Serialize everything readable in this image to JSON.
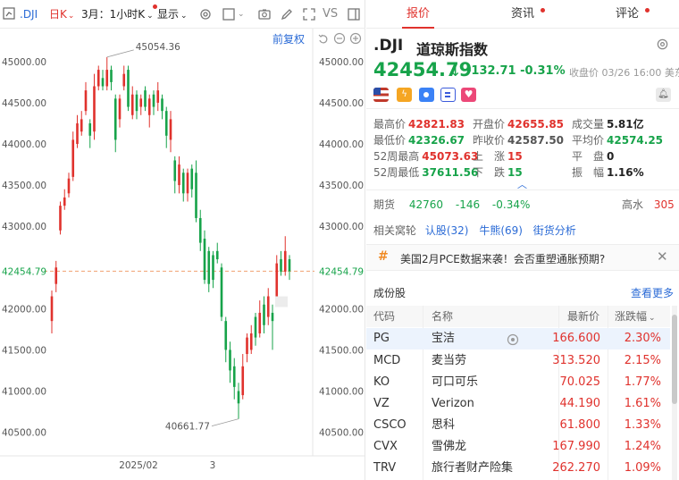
{
  "toolbar": {
    "symbol": ".DJI",
    "period": "日K",
    "range": "3月：1小时K",
    "display": "显示",
    "vs": "VS"
  },
  "chart": {
    "restore_label": "前复权",
    "current_price_label": "42454.79",
    "high_label": "45054.36",
    "low_label": "40661.77",
    "y_ticks": [
      "45000.00",
      "44500.00",
      "44000.00",
      "43500.00",
      "43000.00",
      "42000.00",
      "41500.00",
      "41000.00",
      "40500.00"
    ],
    "x_ticks": [
      "2025/02",
      "3"
    ]
  },
  "chart_data": {
    "type": "candlestick",
    "ylim": [
      40300,
      45400
    ],
    "current_price": 42454.79,
    "high": 45054.36,
    "low": 40661.77,
    "up_color": "#e0322d",
    "down_color": "#17a34a",
    "candles": [
      {
        "o": 41850,
        "c": 42150,
        "h": 42220,
        "l": 41700
      },
      {
        "o": 42300,
        "c": 42500,
        "h": 42580,
        "l": 42200
      },
      {
        "o": 42950,
        "c": 43250,
        "h": 43300,
        "l": 42900
      },
      {
        "o": 43250,
        "c": 43350,
        "h": 43450,
        "l": 43200
      },
      {
        "o": 43400,
        "c": 43580,
        "h": 43650,
        "l": 43350
      },
      {
        "o": 43600,
        "c": 44050,
        "h": 44150,
        "l": 43550
      },
      {
        "o": 44000,
        "c": 44250,
        "h": 44350,
        "l": 43950
      },
      {
        "o": 44150,
        "c": 44300,
        "h": 44400,
        "l": 44100
      },
      {
        "o": 44400,
        "c": 44650,
        "h": 44750,
        "l": 44350
      },
      {
        "o": 44250,
        "c": 44100,
        "h": 44300,
        "l": 43950
      },
      {
        "o": 44150,
        "c": 44700,
        "h": 44850,
        "l": 44050
      },
      {
        "o": 44700,
        "c": 44900,
        "h": 44950,
        "l": 44650
      },
      {
        "o": 44800,
        "c": 44700,
        "h": 44900,
        "l": 44650
      },
      {
        "o": 44700,
        "c": 44900,
        "h": 45054,
        "l": 44650
      },
      {
        "o": 44900,
        "c": 44750,
        "h": 44950,
        "l": 44650
      },
      {
        "o": 44550,
        "c": 44050,
        "h": 44600,
        "l": 43900
      },
      {
        "o": 44300,
        "c": 44550,
        "h": 44600,
        "l": 44200
      },
      {
        "o": 44700,
        "c": 44850,
        "h": 44950,
        "l": 44650
      },
      {
        "o": 44900,
        "c": 44450,
        "h": 44950,
        "l": 44400
      },
      {
        "o": 44350,
        "c": 44600,
        "h": 44700,
        "l": 44300
      },
      {
        "o": 44600,
        "c": 44400,
        "h": 44650,
        "l": 44300
      },
      {
        "o": 44450,
        "c": 44550,
        "h": 44600,
        "l": 44350
      },
      {
        "o": 44650,
        "c": 44450,
        "h": 44700,
        "l": 44400
      },
      {
        "o": 44350,
        "c": 44550,
        "h": 44600,
        "l": 44200
      },
      {
        "o": 44600,
        "c": 44450,
        "h": 44650,
        "l": 44350
      },
      {
        "o": 44500,
        "c": 44650,
        "h": 44750,
        "l": 44400
      },
      {
        "o": 44550,
        "c": 44400,
        "h": 44600,
        "l": 44300
      },
      {
        "o": 44400,
        "c": 44100,
        "h": 44450,
        "l": 43950
      },
      {
        "o": 44050,
        "c": 44300,
        "h": 44400,
        "l": 43900
      },
      {
        "o": 43800,
        "c": 43550,
        "h": 43850,
        "l": 43400
      },
      {
        "o": 43500,
        "c": 43750,
        "h": 43850,
        "l": 43400
      },
      {
        "o": 43650,
        "c": 43400,
        "h": 43700,
        "l": 43300
      },
      {
        "o": 43400,
        "c": 43650,
        "h": 43700,
        "l": 43300
      },
      {
        "o": 43700,
        "c": 43450,
        "h": 43750,
        "l": 43350
      },
      {
        "o": 43650,
        "c": 43100,
        "h": 43800,
        "l": 43050
      },
      {
        "o": 43100,
        "c": 42800,
        "h": 43200,
        "l": 42700
      },
      {
        "o": 42850,
        "c": 42350,
        "h": 42950,
        "l": 42300
      },
      {
        "o": 42700,
        "c": 42300,
        "h": 42750,
        "l": 42200
      },
      {
        "o": 42650,
        "c": 42350,
        "h": 42700,
        "l": 42250
      },
      {
        "o": 42700,
        "c": 42600,
        "h": 42800,
        "l": 42550
      },
      {
        "o": 42500,
        "c": 41900,
        "h": 42550,
        "l": 41850
      },
      {
        "o": 41850,
        "c": 41500,
        "h": 41900,
        "l": 41350
      },
      {
        "o": 41500,
        "c": 41250,
        "h": 41600,
        "l": 41100
      },
      {
        "o": 41300,
        "c": 41050,
        "h": 41400,
        "l": 40900
      },
      {
        "o": 41000,
        "c": 40850,
        "h": 41100,
        "l": 40662
      },
      {
        "o": 40950,
        "c": 41300,
        "h": 41450,
        "l": 40900
      },
      {
        "o": 41450,
        "c": 41650,
        "h": 41700,
        "l": 41350
      },
      {
        "o": 41500,
        "c": 41700,
        "h": 41800,
        "l": 41450
      },
      {
        "o": 41900,
        "c": 41650,
        "h": 41950,
        "l": 41550
      },
      {
        "o": 41700,
        "c": 41950,
        "h": 42100,
        "l": 41650
      },
      {
        "o": 42050,
        "c": 41800,
        "h": 42150,
        "l": 41700
      },
      {
        "o": 41900,
        "c": 42150,
        "h": 42250,
        "l": 41800
      },
      {
        "o": 41950,
        "c": 41850,
        "h": 42050,
        "l": 41500
      },
      {
        "o": 42150,
        "c": 42550,
        "h": 42650,
        "l": 42100
      },
      {
        "o": 42600,
        "c": 42450,
        "h": 42700,
        "l": 42400
      },
      {
        "o": 42450,
        "c": 42700,
        "h": 42880,
        "l": 42400
      },
      {
        "o": 42600,
        "c": 42455,
        "h": 42650,
        "l": 42350
      }
    ]
  },
  "tabs": [
    {
      "label": "报价",
      "active": true
    },
    {
      "label": "资讯",
      "active": false
    },
    {
      "label": "评论",
      "active": false
    }
  ],
  "quote": {
    "ticker": ".DJI",
    "name": "道琼斯指数",
    "price": "42454.79",
    "change": "-132.71",
    "change_pct": "-0.31%",
    "closed_note": "收盘价 03/26 16:00 美东"
  },
  "stats": {
    "high_label": "最高价",
    "high": "42821.83",
    "open_label": "开盘价",
    "open": "42655.85",
    "volume_label": "成交量",
    "volume": "5.81亿",
    "low_label": "最低价",
    "low": "42326.67",
    "prev_close_label": "昨收价",
    "prev_close": "42587.50",
    "avg_label": "平均价",
    "avg": "42574.25",
    "wk52_high_label": "52周最高",
    "wk52_high": "45073.63",
    "up_label": "上　涨",
    "up": "15",
    "flat_label": "平　盘",
    "flat": "0",
    "wk52_low_label": "52周最低",
    "wk52_low": "37611.56",
    "down_label": "下　跌",
    "down": "15",
    "amp_label": "振　幅",
    "amp": "1.16%"
  },
  "futures": {
    "label": "期货",
    "price": "42760",
    "change": "-146",
    "change_pct": "-0.34%",
    "premium_label": "高水",
    "premium": "305"
  },
  "related": {
    "label": "相关窝轮",
    "warrants": "认股(32)",
    "bullbear": "牛熊(69)",
    "analysis": "街货分析"
  },
  "notice": {
    "text": "美国2月PCE数据来袭！会否重塑通胀预期?"
  },
  "constituents": {
    "title": "成份股",
    "more": "查看更多",
    "headers": {
      "code": "代码",
      "name": "名称",
      "price": "最新价",
      "pct": "涨跌幅"
    },
    "rows": [
      {
        "code": "PG",
        "name": "宝洁",
        "price": "166.600",
        "pct": "2.30%"
      },
      {
        "code": "MCD",
        "name": "麦当劳",
        "price": "313.520",
        "pct": "2.15%"
      },
      {
        "code": "KO",
        "name": "可口可乐",
        "price": "70.025",
        "pct": "1.77%"
      },
      {
        "code": "VZ",
        "name": "Verizon",
        "price": "44.190",
        "pct": "1.61%"
      },
      {
        "code": "CSCO",
        "name": "思科",
        "price": "61.800",
        "pct": "1.33%"
      },
      {
        "code": "CVX",
        "name": "雪佛龙",
        "price": "167.990",
        "pct": "1.24%"
      },
      {
        "code": "TRV",
        "name": "旅行者财产险集",
        "price": "262.270",
        "pct": "1.09%"
      }
    ]
  },
  "colors": {
    "up": "#e0322d",
    "down": "#17a34a",
    "accent": "#2b6bd6"
  }
}
